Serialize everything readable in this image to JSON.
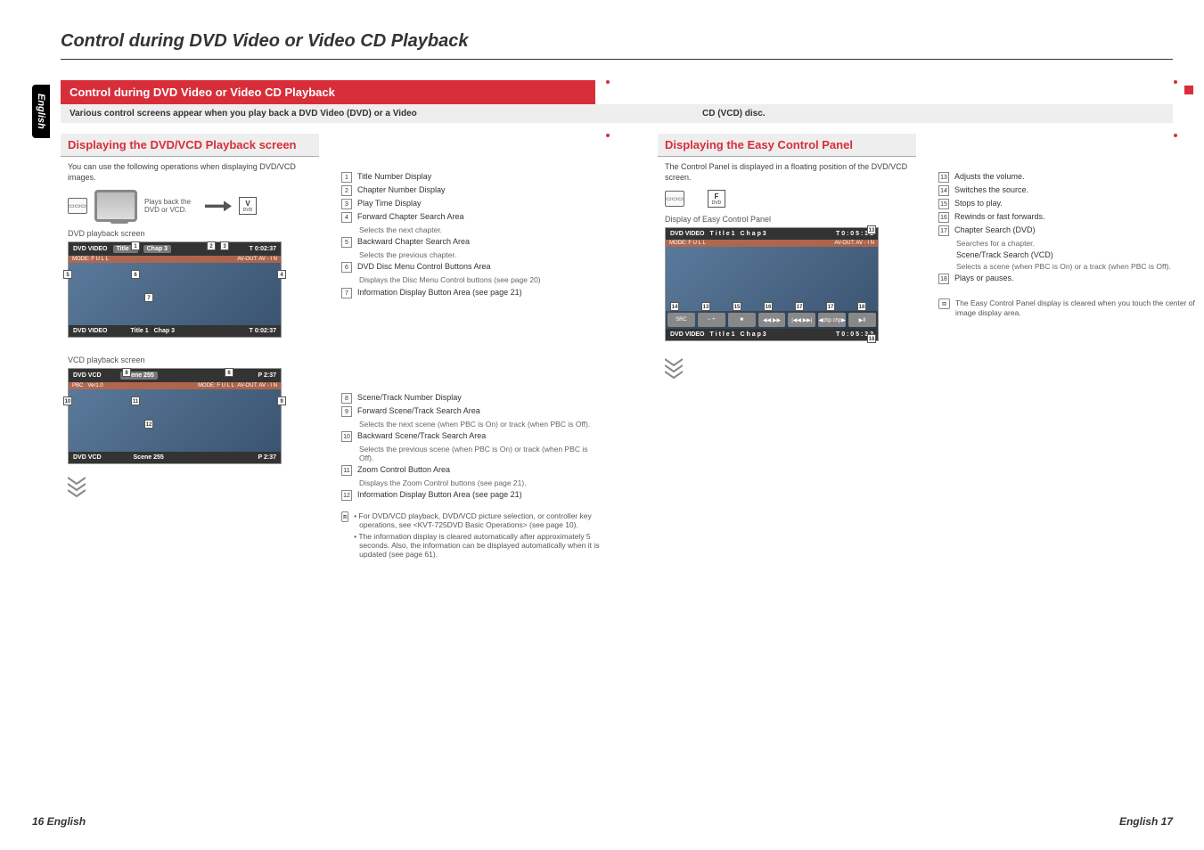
{
  "page_title": "Control during DVD Video or Video CD Playback",
  "lang_tab": "English",
  "top_band": "Control during DVD Video or Video CD Playback",
  "sub_band_left": "Various control screens appear when you play back a DVD Video (DVD) or a Video",
  "sub_band_right": "CD (VCD) disc.",
  "footer_left": "16 English",
  "footer_right": "English 17",
  "col1": {
    "sec_title": "Displaying the DVD/VCD Playback screen",
    "intro": "You can use the following operations when displaying DVD/VCD images.",
    "play_desc": "Plays back the DVD or VCD.",
    "mode_label": "V",
    "mode_sub": "DVD",
    "dvd_head": "DVD playback screen",
    "dvd_top": {
      "src": "DVD VIDEO",
      "title": "Title 1",
      "chap": "Chap 3",
      "time": "T   0:02:37"
    },
    "dvd_strip": {
      "mode": "MODE: F U L L",
      "av": "AV-OUT: AV - I N"
    },
    "dvd_bot": {
      "src": "DVD VIDEO",
      "title": "Title 1",
      "chap": "Chap 3",
      "time": "T   0:02:37"
    },
    "vcd_head": "VCD playback screen",
    "vcd_top": {
      "src": "DVD VCD",
      "scene": "Scene 255",
      "time": "P   2:37"
    },
    "vcd_strip_pbc": "PBC",
    "vcd_strip_ver": "Ver1.0",
    "vcd_bot": {
      "src": "DVD VCD",
      "scene": "Scene 255",
      "time": "P   2:37"
    }
  },
  "col2": {
    "items": [
      {
        "n": "1",
        "t": "Title Number Display"
      },
      {
        "n": "2",
        "t": "Chapter Number Display"
      },
      {
        "n": "3",
        "t": "Play Time Display"
      },
      {
        "n": "4",
        "t": "Forward Chapter Search Area",
        "s": "Selects the next chapter."
      },
      {
        "n": "5",
        "t": "Backward Chapter Search Area",
        "s": "Selects the previous chapter."
      },
      {
        "n": "6",
        "t": "DVD Disc Menu Control Buttons Area",
        "s": "Displays the Disc Menu Control buttons (see page 20)"
      },
      {
        "n": "7",
        "t": "Information Display Button Area (see page 21)"
      }
    ],
    "items2": [
      {
        "n": "8",
        "t": "Scene/Track Number Display"
      },
      {
        "n": "9",
        "t": "Forward Scene/Track Search Area",
        "s": "Selects the next scene (when PBC is On) or track (when PBC is Off)."
      },
      {
        "n": "10",
        "t": "Backward Scene/Track Search Area",
        "s": "Selects the previous scene (when PBC is On) or track (when PBC is Off)."
      },
      {
        "n": "11",
        "t": "Zoom Control Button Area",
        "s": "Displays the Zoom Control buttons (see page 21)."
      },
      {
        "n": "12",
        "t": "Information Display Button Area (see page 21)"
      }
    ],
    "notes": [
      "For DVD/VCD playback, DVD/VCD picture selection, or controller key operations, see <KVT-725DVD Basic Operations> (see page 10).",
      "The information display is cleared automatically after approximately 5 seconds. Also, the information can be displayed automatically when it is updated (see page 61)."
    ]
  },
  "col3": {
    "sec_title": "Displaying the Easy Control Panel",
    "intro": "The Control Panel is displayed in a floating position of the DVD/VCD screen.",
    "mode_label": "F",
    "mode_sub": "DVD",
    "easy_head": "Display of Easy Control Panel",
    "panel_top": {
      "src": "DVD VIDEO",
      "title": "T i t l e  1",
      "chap": "C h a p  3",
      "time": "T  0 : 0 5 : 3 2"
    },
    "panel_strip": {
      "mode": "MODE: F U L L",
      "av": "AV-OUT: AV - I N"
    },
    "panel_bot": {
      "src": "DVD VIDEO",
      "title": "T i t l e  1",
      "chap": "C h a p  3",
      "time": "T  0 : 0 5 : 3 2"
    },
    "ep_buttons": [
      "SRC",
      "−  +",
      "■",
      "◀◀  ▶▶",
      "|◀◀  ▶▶|",
      "◀chp  chp▶",
      "▶II"
    ]
  },
  "col4": {
    "items": [
      {
        "n": "13",
        "t": "Adjusts the volume."
      },
      {
        "n": "14",
        "t": "Switches the source."
      },
      {
        "n": "15",
        "t": "Stops to play."
      },
      {
        "n": "16",
        "t": "Rewinds or fast forwards."
      },
      {
        "n": "17",
        "t": "Chapter Search (DVD)",
        "s": "Searches for a chapter."
      },
      {
        "n": "",
        "t": "Scene/Track Search (VCD)",
        "s": "Selects a scene (when PBC is On) or a track (when PBC is Off)."
      },
      {
        "n": "18",
        "t": "Plays or pauses."
      }
    ],
    "note": "The Easy Control Panel display is cleared when you touch the center of image display area."
  }
}
